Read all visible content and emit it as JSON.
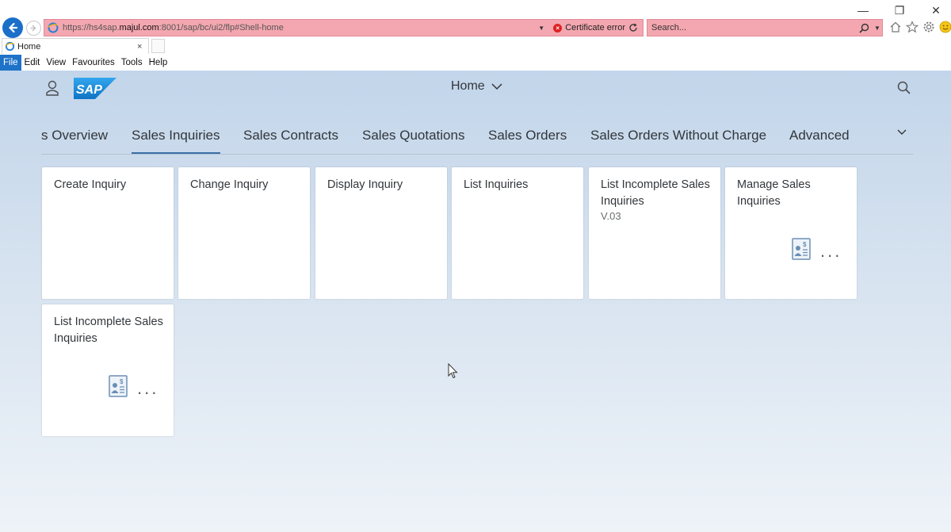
{
  "browser": {
    "window_controls": {
      "minimize": "—",
      "restore": "❐",
      "close": "✕"
    },
    "address": {
      "url_prefix": "https://hs4sap.",
      "url_domain": "majul.com",
      "url_suffix": ":8001/sap/bc/ui2/flp#Shell-home",
      "certificate_error": "Certificate error"
    },
    "search": {
      "placeholder": "Search..."
    },
    "tab": {
      "title": "Home",
      "close": "×"
    },
    "menu": {
      "items": [
        {
          "label": "File"
        },
        {
          "label": "Edit"
        },
        {
          "label": "View"
        },
        {
          "label": "Favourites"
        },
        {
          "label": "Tools"
        },
        {
          "label": "Help"
        }
      ]
    }
  },
  "shell": {
    "title": "Home",
    "tabs": [
      {
        "label": "s Overview"
      },
      {
        "label": "Sales Inquiries"
      },
      {
        "label": "Sales Contracts"
      },
      {
        "label": "Sales Quotations"
      },
      {
        "label": "Sales Orders"
      },
      {
        "label": "Sales Orders Without Charge"
      },
      {
        "label": "Advanced"
      }
    ],
    "selected_tab": "Sales Inquiries"
  },
  "tiles": [
    {
      "title": "Create Inquiry",
      "subtitle": ""
    },
    {
      "title": "Change Inquiry",
      "subtitle": ""
    },
    {
      "title": "Display Inquiry",
      "subtitle": ""
    },
    {
      "title": "List Inquiries",
      "subtitle": ""
    },
    {
      "title": "List Incomplete Sales Inquiries",
      "subtitle": "V.03"
    },
    {
      "title": "Manage Sales Inquiries",
      "subtitle": "",
      "more": "..."
    },
    {
      "title": "List Incomplete Sales Inquiries",
      "subtitle": "",
      "more": "..."
    }
  ],
  "colors": {
    "address_error_bg": "#f4a7b0",
    "menu_active": "#1e72c8",
    "sap_blue": "#1a8cd8",
    "tab_underline": "#3a6ea5",
    "text": "#32363a"
  }
}
